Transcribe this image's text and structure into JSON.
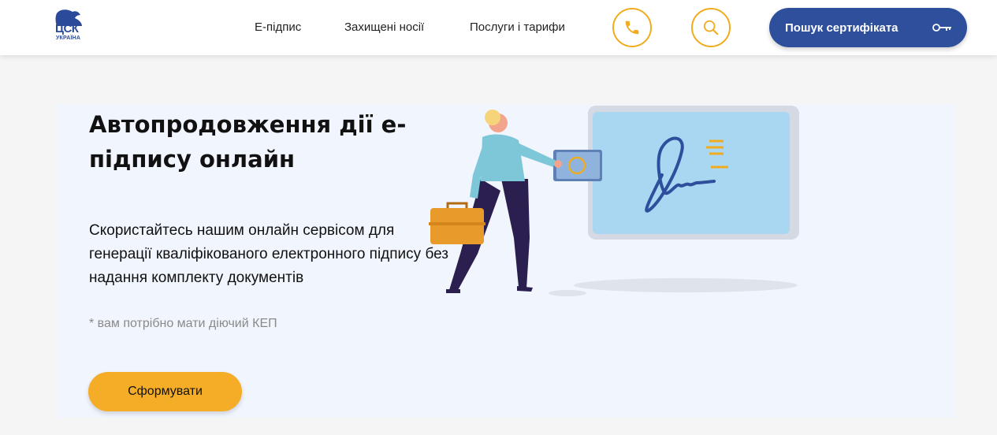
{
  "brand": {
    "logo_text": "ЦСК",
    "logo_subtext": "УКРАЇНА",
    "color": "#2c4a9a"
  },
  "nav": {
    "items": [
      {
        "label": "Е-підпис"
      },
      {
        "label": "Захищені носії"
      },
      {
        "label": "Послуги і тарифи"
      }
    ],
    "phone_icon": "phone-icon",
    "search_icon": "search-icon",
    "cert_search_label": "Пошук сертифіката",
    "cert_search_icon": "key-icon"
  },
  "hero": {
    "title": "Автопродовження дії е-підпису онлайн",
    "description": "Скористайтесь нашим онлайн сервісом для генерації кваліфікованого електронного підпису без надання комплекту документів",
    "note": "* вам потрібно мати діючий КЕП",
    "button_label": "Сформувати"
  },
  "colors": {
    "accent": "#f5ad27",
    "primary": "#2e4f9c",
    "hero_bg": "#f1f5fd"
  }
}
